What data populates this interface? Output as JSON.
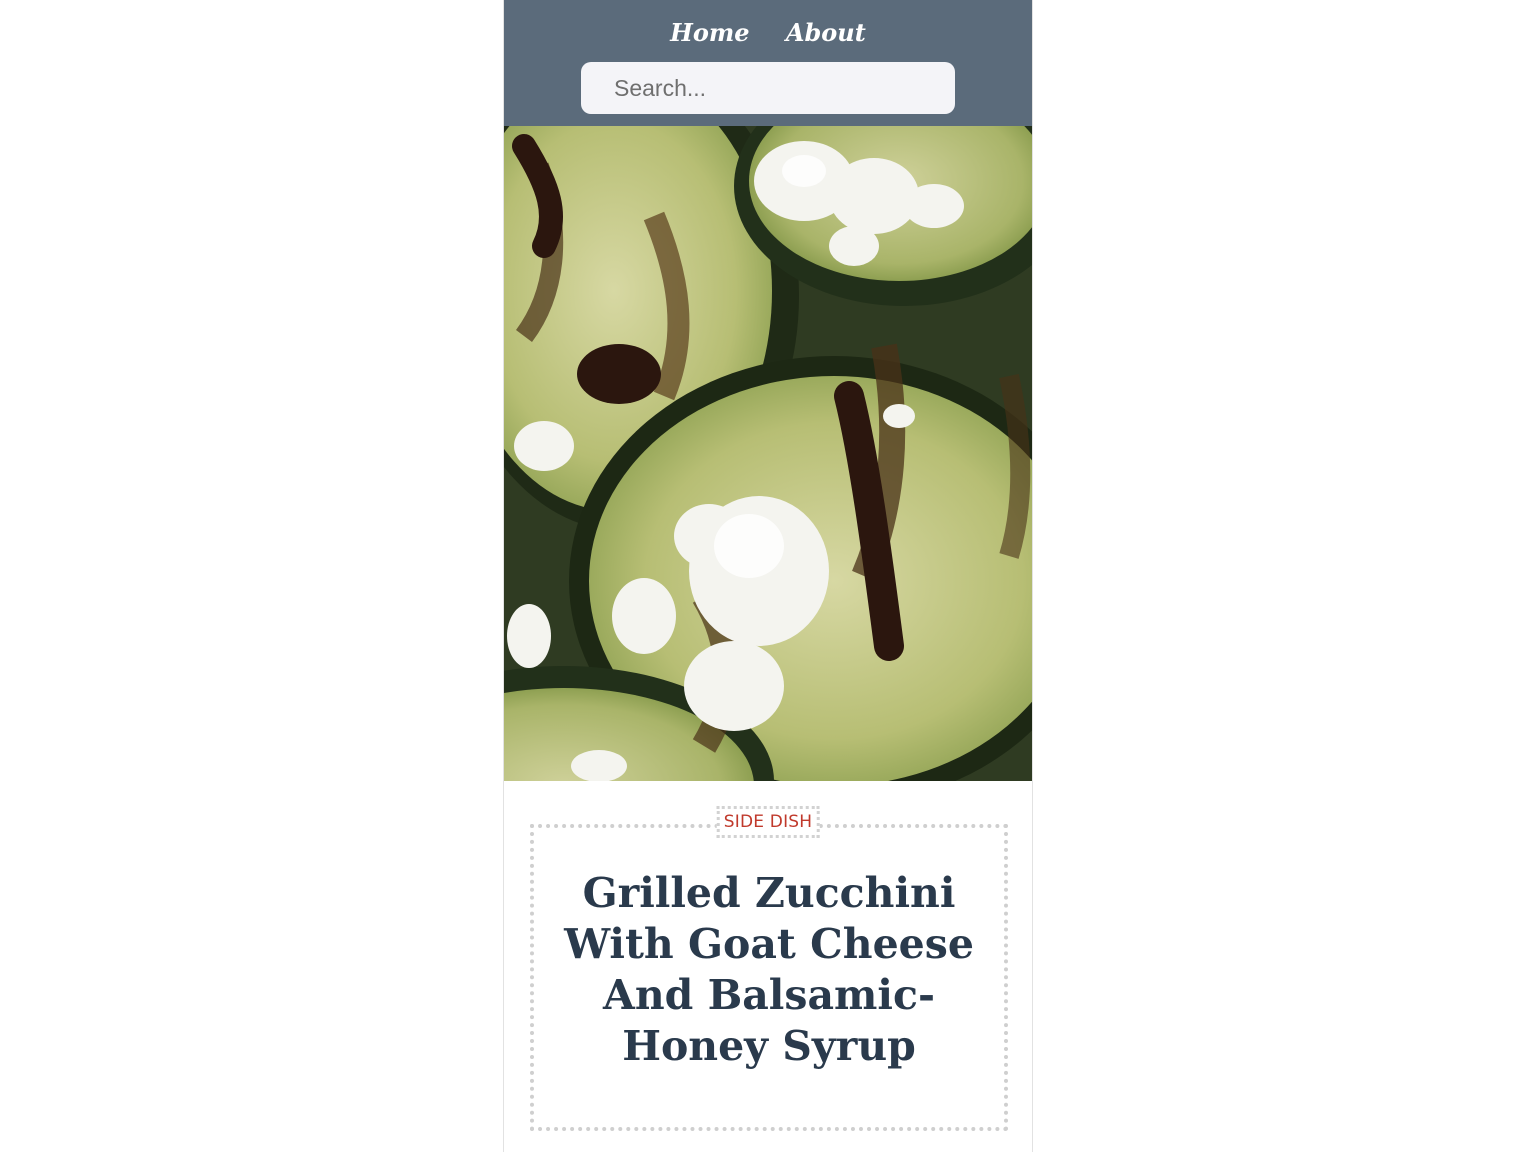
{
  "nav": {
    "items": [
      {
        "label": "Home"
      },
      {
        "label": "About"
      }
    ]
  },
  "search": {
    "placeholder": "Search..."
  },
  "hero": {
    "alt": "Grilled zucchini slices topped with goat cheese and balsamic syrup"
  },
  "post": {
    "category": "SIDE DISH",
    "title": "Grilled Zucchini With Goat Cheese And Balsamic-Honey Syrup"
  },
  "colors": {
    "header_bg": "#5b6b7b",
    "category_text": "#c0392b",
    "title_text": "#2a3a4c"
  }
}
